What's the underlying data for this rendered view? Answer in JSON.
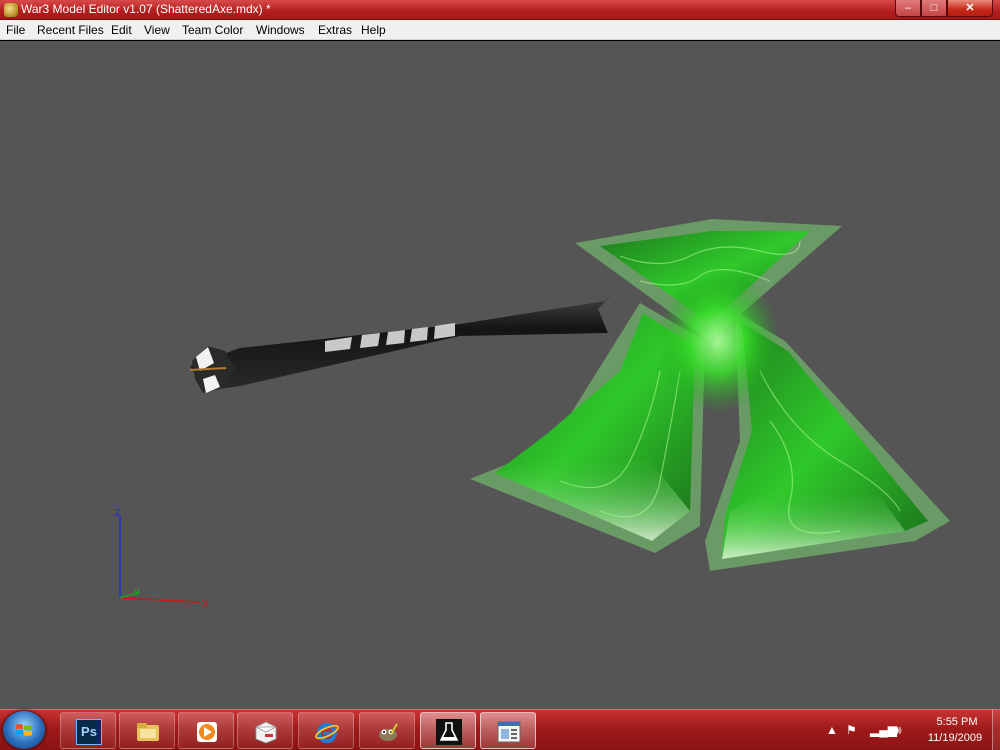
{
  "window": {
    "title": "War3 Model Editor v1.07 (ShatteredAxe.mdx) *",
    "min_glyph": "‒",
    "max_glyph": "□",
    "close_glyph": "✕"
  },
  "menu": {
    "items": [
      "File",
      "Recent Files",
      "Edit",
      "View",
      "Team Color",
      "Windows",
      "Extras",
      "Help"
    ]
  },
  "viewport": {
    "background_color": "#555555",
    "axis_labels": {
      "z": "Z",
      "y": "y",
      "x": "X"
    },
    "axis_colors": {
      "z": "#1f2fd8",
      "y": "#1aa81a",
      "x": "#c81a1a"
    }
  },
  "taskbar": {
    "apps": [
      {
        "name": "photoshop",
        "icon": "photoshop-icon",
        "text": "Ps"
      },
      {
        "name": "file-explorer",
        "icon": "folder-icon"
      },
      {
        "name": "media-player",
        "icon": "media-player-icon"
      },
      {
        "name": "mpq-editor",
        "icon": "box-icon"
      },
      {
        "name": "internet-explorer",
        "icon": "ie-icon"
      },
      {
        "name": "gimp",
        "icon": "gimp-icon"
      },
      {
        "name": "lab-app",
        "icon": "flask-icon"
      },
      {
        "name": "war3-model-editor",
        "icon": "model-editor-icon"
      }
    ],
    "tray": {
      "time": "5:55 PM",
      "date": "11/19/2009"
    }
  }
}
